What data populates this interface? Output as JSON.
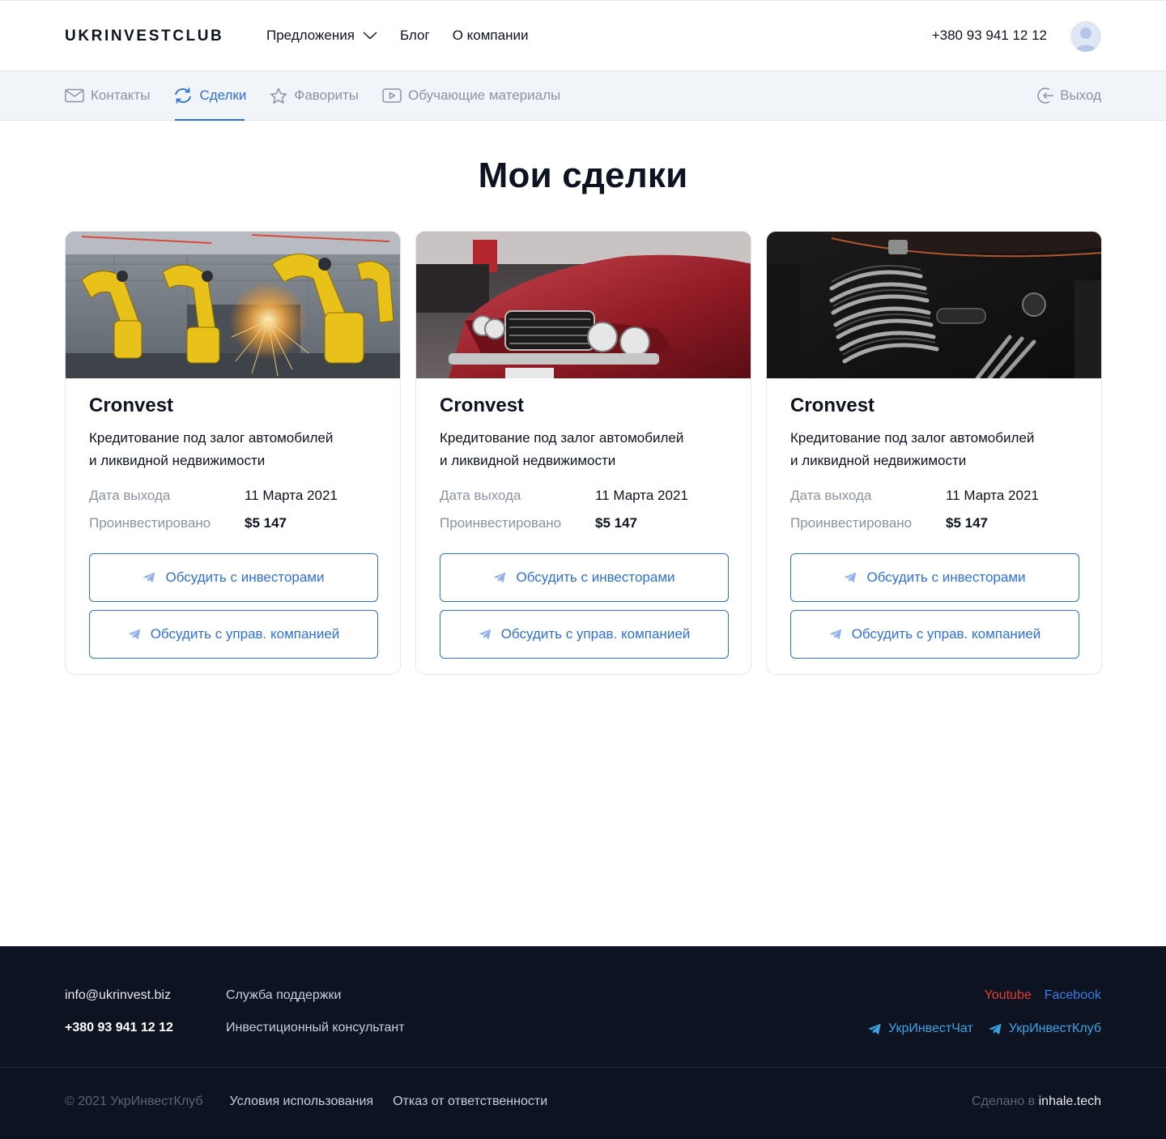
{
  "header": {
    "logo": "UKRINVESTCLUB",
    "nav": [
      {
        "label": "Предложения"
      },
      {
        "label": "Блог"
      },
      {
        "label": "О компании"
      }
    ],
    "phone": "+380 93 941 12 12"
  },
  "subnav": {
    "tabs": [
      {
        "label": "Контакты",
        "icon": "mail-icon"
      },
      {
        "label": "Сделки",
        "icon": "sync-icon"
      },
      {
        "label": "Фавориты",
        "icon": "star-icon"
      },
      {
        "label": "Обучающие материалы",
        "icon": "play-icon"
      }
    ],
    "active_tab": "Сделки",
    "logout": "Выход"
  },
  "page": {
    "title": "Мои сделки"
  },
  "cards": [
    {
      "image": "industrial-robots",
      "company": "Cronvest",
      "desc_line1": "Кредитование под залог автомобилей",
      "desc_line2": "и ликвидной недвижимости",
      "release_label": "Дата выхода",
      "release_value": "11 Марта 2021",
      "invested_label": "Проинвестировано",
      "invested_value": "$5 147",
      "btn_investors": "Обсудить с инвесторами",
      "btn_company": "Обсудить с управ. компанией"
    },
    {
      "image": "red-classic-car",
      "company": "Cronvest",
      "desc_line1": "Кредитование под залог автомобилей",
      "desc_line2": "и ликвидной недвижимости",
      "release_label": "Дата выхода",
      "release_value": "11 Марта 2021",
      "invested_label": "Проинвестировано",
      "invested_value": "$5 147",
      "btn_investors": "Обсудить с инвесторами",
      "btn_company": "Обсудить с управ. компанией"
    },
    {
      "image": "motorcycle-engine",
      "company": "Cronvest",
      "desc_line1": "Кредитование под залог автомобилей",
      "desc_line2": "и ликвидной недвижимости",
      "release_label": "Дата выхода",
      "release_value": "11 Марта 2021",
      "invested_label": "Проинвестировано",
      "invested_value": "$5 147",
      "btn_investors": "Обсудить с инвесторами",
      "btn_company": "Обсудить с управ. компанией"
    }
  ],
  "footer": {
    "email": "info@ukrinvest.biz",
    "phone": "+380 93 941 12 12",
    "support": "Служба поддержки",
    "consultant": "Инвестиционный консультант",
    "youtube": "Youtube",
    "facebook": "Facebook",
    "tg_chat": "УкрИнвестЧат",
    "tg_club": "УкрИнвестКлуб",
    "copyright": "© 2021 УкрИнвестКлуб",
    "terms": "Условия использования",
    "disclaimer": "Отказ от ответственности",
    "made_by": "Сделано в",
    "made_brand": "inhale.tech"
  },
  "colors": {
    "accent": "#2e6fd8",
    "footer_bg": "#0d1321",
    "youtube": "#e5403a",
    "facebook": "#3b7ce6",
    "telegram": "#3aa3e6"
  }
}
